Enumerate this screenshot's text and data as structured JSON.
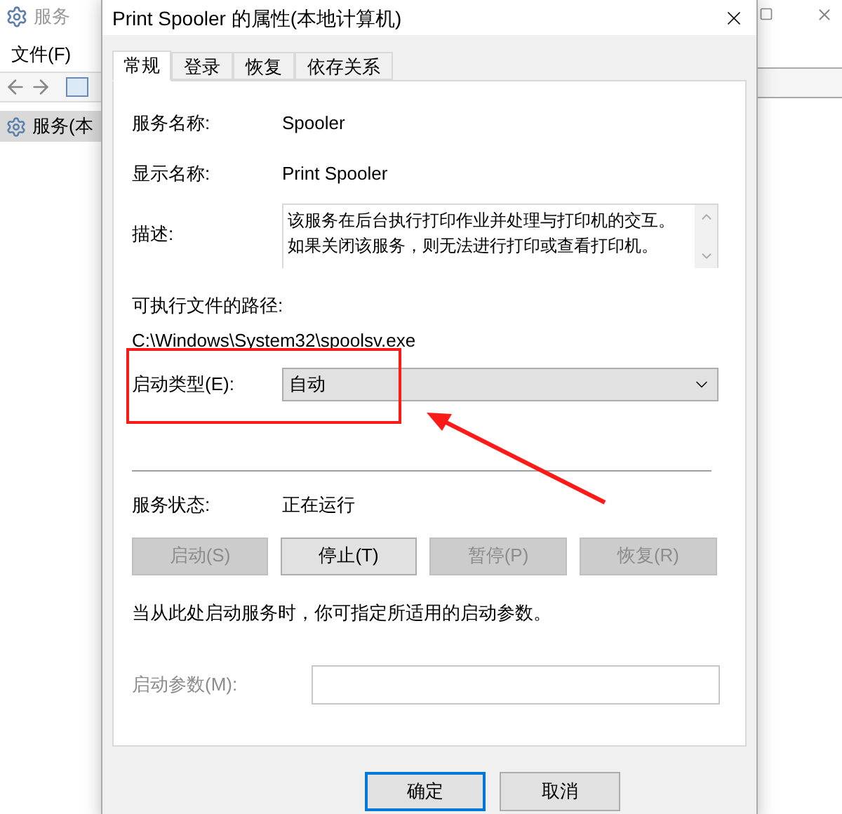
{
  "background_window": {
    "title": "服务",
    "menu": [
      "文件(F)"
    ],
    "tree": [
      {
        "label": "服务(本",
        "selected": true
      }
    ]
  },
  "dialog": {
    "title": "Print Spooler 的属性(本地计算机)",
    "tabs": [
      {
        "label": "常规",
        "selected": true
      },
      {
        "label": "登录",
        "selected": false
      },
      {
        "label": "恢复",
        "selected": false
      },
      {
        "label": "依存关系",
        "selected": false
      }
    ],
    "service_name": {
      "label": "服务名称:",
      "value": "Spooler"
    },
    "display_name": {
      "label": "显示名称:",
      "value": "Print Spooler"
    },
    "description": {
      "label": "描述:",
      "value": "该服务在后台执行打印作业并处理与打印机的交互。如果关闭该服务，则无法进行打印或查看打印机。"
    },
    "executable_path": {
      "label": "可执行文件的路径:",
      "value": "C:\\Windows\\System32\\spoolsv.exe"
    },
    "startup_type": {
      "label": "启动类型(E):",
      "value": "自动"
    },
    "service_status": {
      "label": "服务状态:",
      "value": "正在运行"
    },
    "control_buttons": [
      {
        "label": "启动(S)",
        "disabled": true
      },
      {
        "label": "停止(T)",
        "disabled": false
      },
      {
        "label": "暂停(P)",
        "disabled": true
      },
      {
        "label": "恢复(R)",
        "disabled": true
      }
    ],
    "hint": "当从此处启动服务时，你可指定所适用的启动参数。",
    "start_parameters": {
      "label": "启动参数(M):",
      "disabled": true
    },
    "footer_buttons": [
      {
        "label": "确定",
        "default": true
      },
      {
        "label": "取消",
        "default": false
      }
    ]
  }
}
